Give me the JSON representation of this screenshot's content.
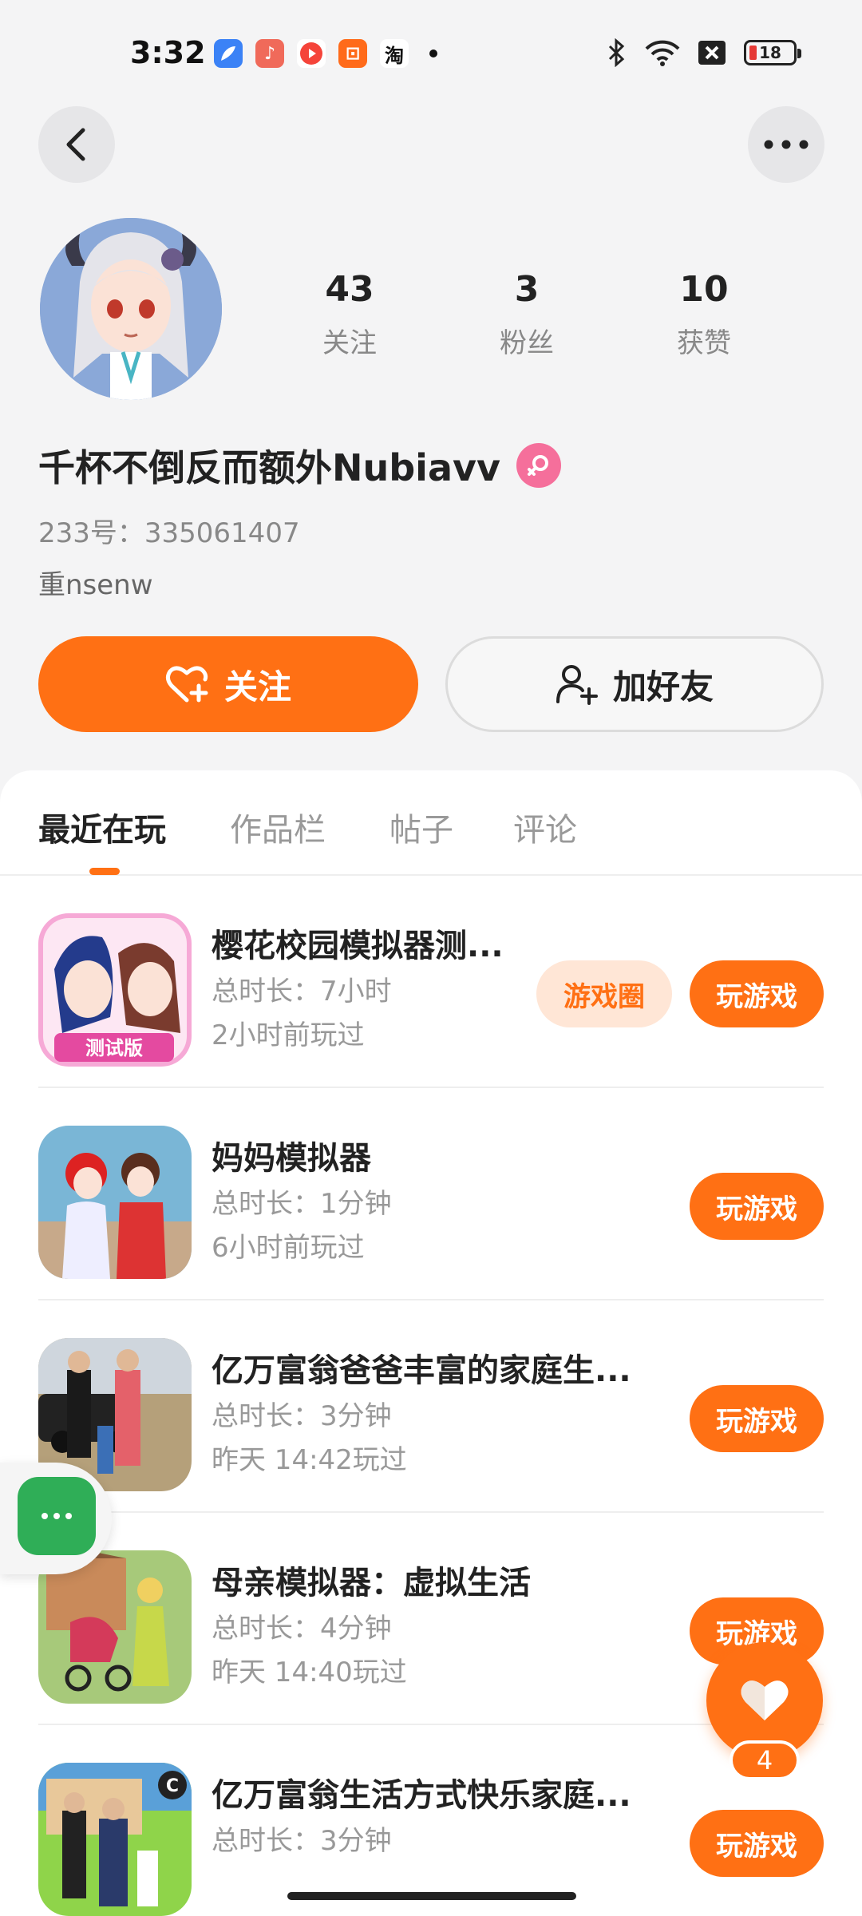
{
  "status_bar": {
    "time": "3:32",
    "apps": [
      {
        "icon": "feather-app-icon",
        "color": "#3b82f6",
        "glyph": ""
      },
      {
        "icon": "music-app-icon",
        "color": "#f06a5a",
        "glyph": "♪"
      },
      {
        "icon": "video-app-icon",
        "color": "#f5443a",
        "glyph": "▶"
      },
      {
        "icon": "kuaishou-app-icon",
        "color": "#ff6b1a",
        "glyph": "⊡"
      },
      {
        "icon": "taobao-app-icon",
        "color": "#ffffff",
        "glyph": "淘"
      }
    ],
    "battery_level": "18"
  },
  "profile": {
    "stats": [
      {
        "value": "43",
        "label": "关注"
      },
      {
        "value": "3",
        "label": "粉丝"
      },
      {
        "value": "10",
        "label": "获赞"
      }
    ],
    "username": "千杯不倒反而额外Nubiavv",
    "uid": "233号：335061407",
    "bio": "重nsenw"
  },
  "actions": {
    "follow_label": "关注",
    "add_friend_label": "加好友"
  },
  "tabs": [
    "最近在玩",
    "作品栏",
    "帖子",
    "评论"
  ],
  "games": [
    {
      "title": "樱花校园模拟器测...",
      "duration": "总时长：7小时",
      "last_played": "2小时前玩过",
      "circle_label": "游戏圈",
      "play_label": "玩游戏"
    },
    {
      "title": "妈妈模拟器",
      "duration": "总时长：1分钟",
      "last_played": "6小时前玩过",
      "play_label": "玩游戏"
    },
    {
      "title": "亿万富翁爸爸丰富的家庭生...",
      "duration": "总时长：3分钟",
      "last_played": "昨天 14:42玩过",
      "play_label": "玩游戏"
    },
    {
      "title": "母亲模拟器：虚拟生活",
      "duration": "总时长：4分钟",
      "last_played": "昨天 14:40玩过",
      "play_label": "玩游戏"
    },
    {
      "title": "亿万富翁生活方式快乐家庭...",
      "duration": "总时长：3分钟",
      "last_played": "",
      "play_label": "玩游戏"
    }
  ],
  "floating": {
    "like_count": "4"
  },
  "colors": {
    "accent": "#ff7014",
    "chat_green": "#2fae57",
    "female_badge": "#f56f9b"
  }
}
